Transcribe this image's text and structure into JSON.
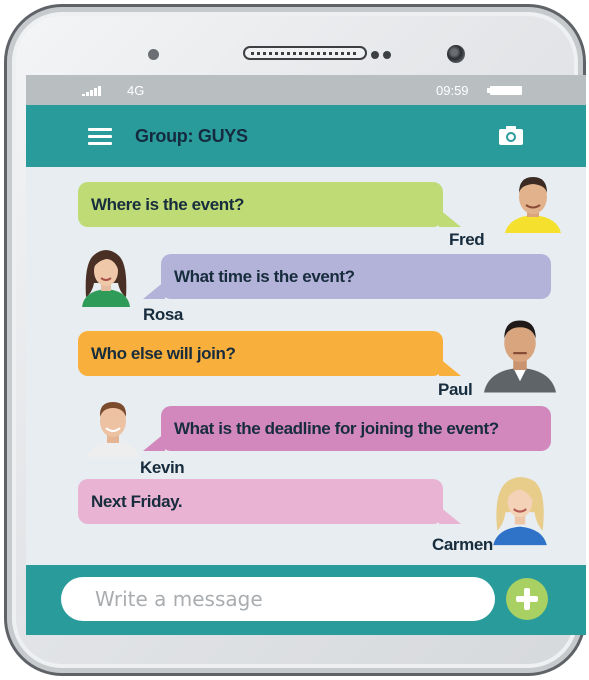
{
  "status_bar": {
    "network": "4G",
    "time": "09:59"
  },
  "header": {
    "title": "Group: GUYS"
  },
  "messages": [
    {
      "sender": "Fred",
      "text": "Where is the event?",
      "color": "#bedb76"
    },
    {
      "sender": "Rosa",
      "text": "What time is the event?",
      "color": "#b3b2d9"
    },
    {
      "sender": "Paul",
      "text": "Who else will join?",
      "color": "#f9af3c"
    },
    {
      "sender": "Kevin",
      "text": "What is the deadline for joining the event?",
      "color": "#d287bd"
    },
    {
      "sender": "Carmen",
      "text": "Next Friday.",
      "color": "#e9b3d3"
    }
  ],
  "composer": {
    "placeholder": "Write a message"
  },
  "icons": {
    "menu": "hamburger-icon",
    "camera": "camera-icon",
    "add": "plus-icon",
    "signal": "signal-icon",
    "battery": "battery-icon"
  },
  "colors": {
    "accent": "#2a9b9b",
    "status_bar": "#b9bec1",
    "add_button": "#a8d063"
  }
}
